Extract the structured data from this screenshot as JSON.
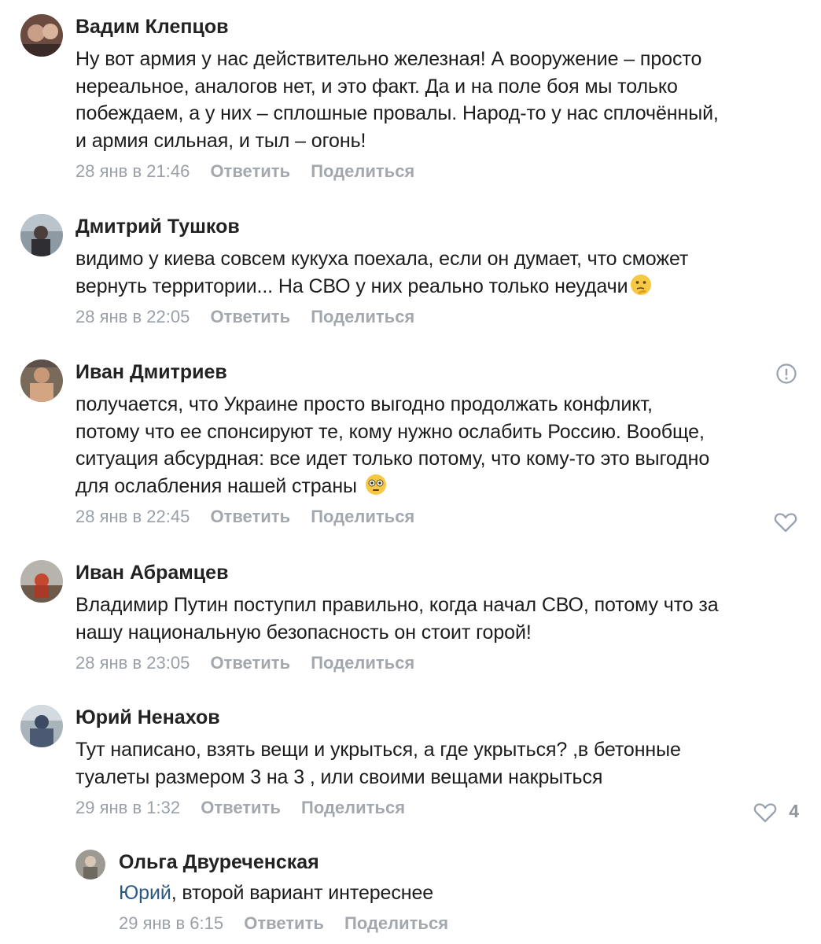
{
  "comments": [
    {
      "author": "Вадим Клепцов",
      "text": "Ну вот армия у нас действительно железная! А вооружение – просто\nнереальное, аналогов нет, и это факт. Да и на поле боя мы только\nпобеждаем, а у них – сплошные провалы. Народ-то у нас сплочённый,\nи армия сильная, и тыл – огонь!",
      "date": "28 янв в 21:46",
      "reply_label": "Ответить",
      "share_label": "Поделиться"
    },
    {
      "author": "Дмитрий Тушков",
      "text": "видимо у киева совсем кукуха поехала, если он думает, что сможет\nвернуть территории... На СВО у них реально только неудачи",
      "emoji": "thinking-face-emoji",
      "date": "28 янв в 22:05",
      "reply_label": "Ответить",
      "share_label": "Поделиться"
    },
    {
      "author": "Иван Дмитриев",
      "text": "получается, что Украине просто выгодно продолжать конфликт,\nпотому что ее спонсируют те, кому нужно ослабить Россию. Вообще,\nситуация абсурдная: все идет только потому, что кому-то это выгодно\nдля ослабления нашей страны",
      "emoji": "flushed-face-emoji",
      "date": "28 янв в 22:45",
      "reply_label": "Ответить",
      "share_label": "Поделиться",
      "report_icon": "report-icon",
      "like_icon": "heart-icon"
    },
    {
      "author": "Иван Абрамцев",
      "text": "Владимир Путин поступил правильно, когда начал СВО, потому что за\nнашу национальную безопасность он стоит горой!",
      "date": "28 янв в 23:05",
      "reply_label": "Ответить",
      "share_label": "Поделиться"
    },
    {
      "author": "Юрий Ненахов",
      "text": "Тут написано, взять вещи и укрыться, а где укрыться? ,в бетонные\nтуалеты размером 3 на 3 , или своими вещами накрыться",
      "date": "29 янв в 1:32",
      "reply_label": "Ответить",
      "share_label": "Поделиться",
      "like_icon": "heart-icon",
      "like_count": "4"
    }
  ],
  "reply": {
    "author": "Ольга Двуреченская",
    "mention": "Юрий",
    "text": ", второй вариант интереснее",
    "date": "29 янв в 6:15",
    "reply_label": "Ответить",
    "share_label": "Поделиться"
  },
  "colors": {
    "meta": "#9aa0a8",
    "mention": "#2a5885",
    "icon": "#99a2ad"
  }
}
